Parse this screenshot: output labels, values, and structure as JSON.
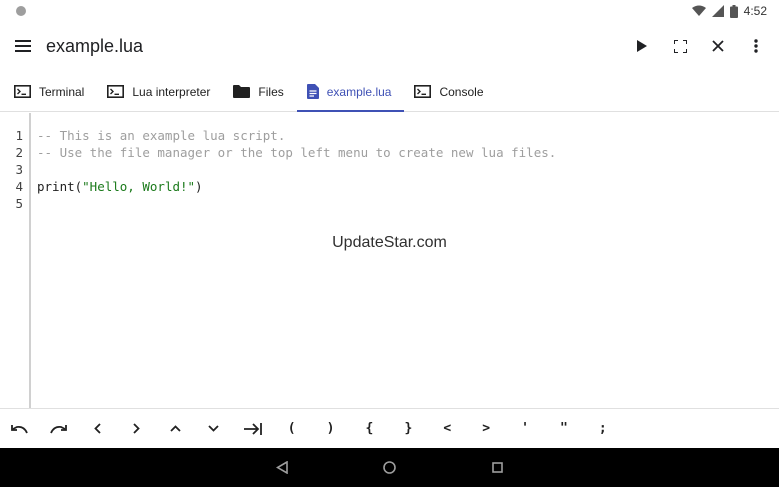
{
  "status": {
    "time": "4:52"
  },
  "appbar": {
    "title": "example.lua",
    "actions": [
      "play-icon",
      "fullscreen-icon",
      "close-icon",
      "more-vert-icon"
    ]
  },
  "tabs": [
    {
      "label": "Terminal",
      "icon": "terminal-icon"
    },
    {
      "label": "Lua interpreter",
      "icon": "terminal-icon"
    },
    {
      "label": "Files",
      "icon": "folder-icon"
    },
    {
      "label": "example.lua",
      "icon": "document-icon",
      "active": true
    },
    {
      "label": "Console",
      "icon": "terminal-icon"
    }
  ],
  "editor": {
    "line_numbers": [
      "1",
      "2",
      "3",
      "4",
      "5"
    ],
    "lines": [
      {
        "comment": "-- This is an example lua script."
      },
      {
        "comment": "-- Use the file manager or the top left menu to create new lua files."
      },
      {
        "plain": ""
      },
      {
        "prefix": "print(",
        "string": "\"Hello, World!\"",
        "suffix": ")"
      },
      {
        "plain": ""
      }
    ]
  },
  "watermark": "UpdateStar.com",
  "symbols": [
    "(",
    ")",
    "{",
    "}",
    "<",
    ">",
    "'",
    "\"",
    ";"
  ],
  "colors": {
    "accent": "#3f51b5",
    "comment": "#9e9e9e",
    "string": "#1b7a1b"
  }
}
